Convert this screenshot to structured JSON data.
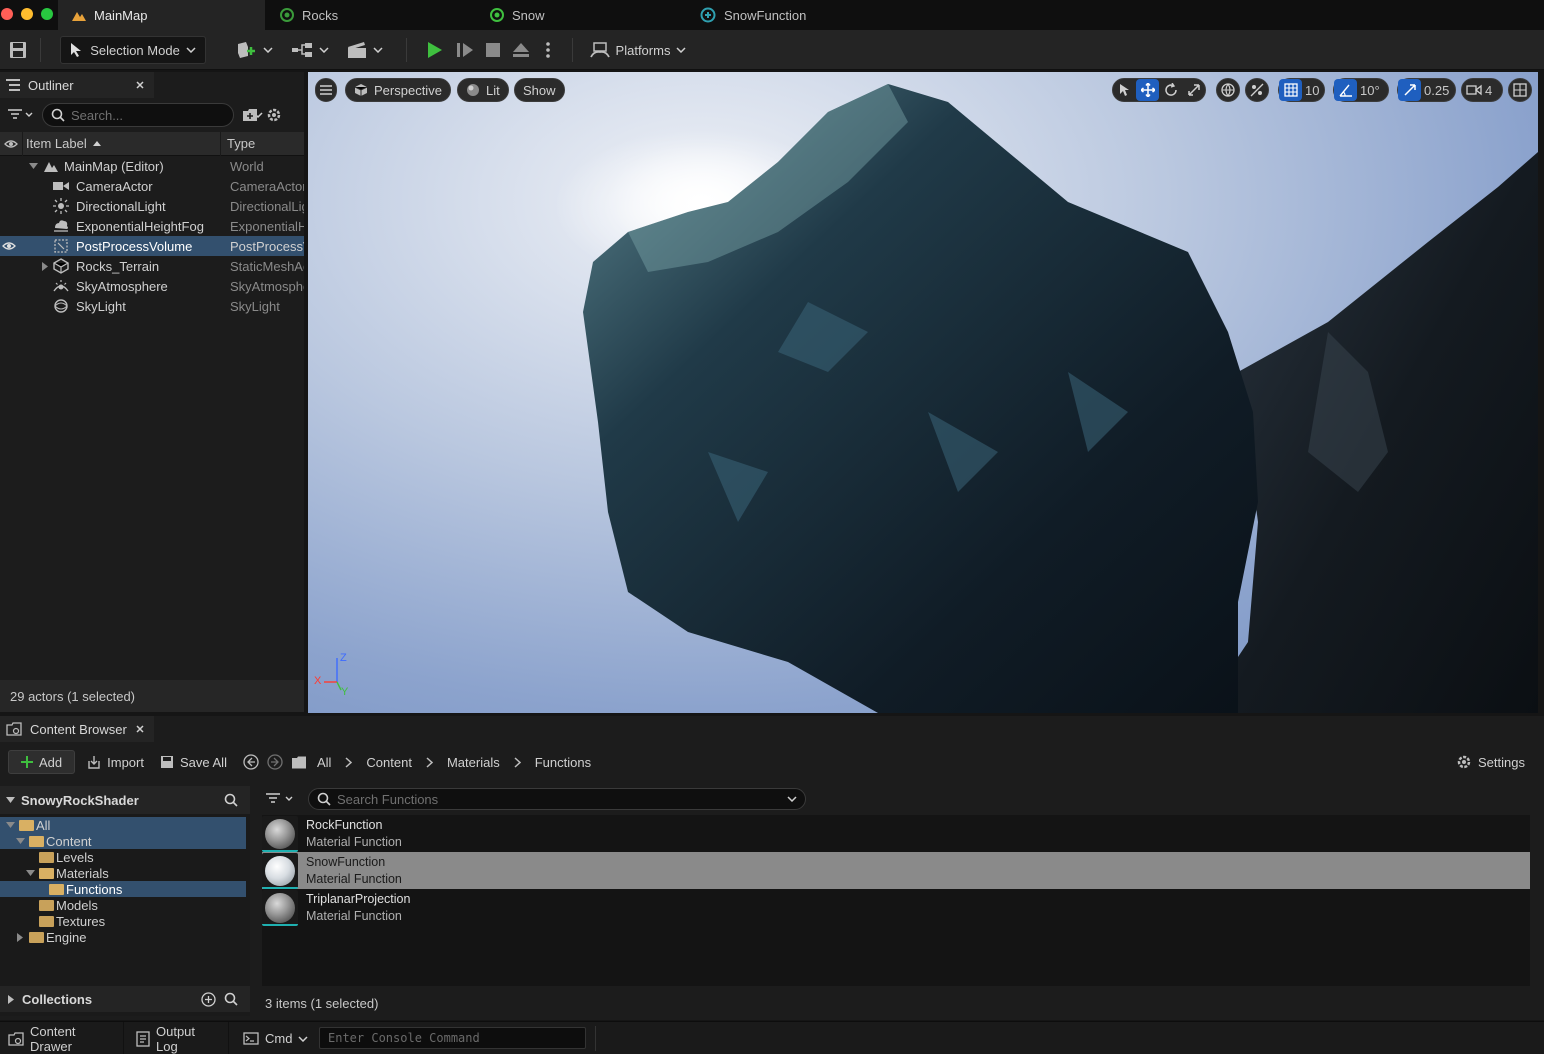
{
  "window": {
    "tabs": [
      {
        "label": "MainMap",
        "active": true
      },
      {
        "label": "Rocks",
        "active": false
      },
      {
        "label": "Snow",
        "active": false
      },
      {
        "label": "SnowFunction",
        "active": false
      }
    ]
  },
  "toolbar": {
    "selection_mode": "Selection Mode",
    "platforms": "Platforms"
  },
  "outliner": {
    "tab_label": "Outliner",
    "search_placeholder": "Search...",
    "col_label": "Item Label",
    "col_type": "Type",
    "rows": [
      {
        "label": "MainMap (Editor)",
        "type": "World"
      },
      {
        "label": "CameraActor",
        "type": "CameraActor"
      },
      {
        "label": "DirectionalLight",
        "type": "DirectionalLight"
      },
      {
        "label": "ExponentialHeightFog",
        "type": "ExponentialHeightFog"
      },
      {
        "label": "PostProcessVolume",
        "type": "PostProcessVolume",
        "selected": true
      },
      {
        "label": "Rocks_Terrain",
        "type": "StaticMeshActor"
      },
      {
        "label": "SkyAtmosphere",
        "type": "SkyAtmosphere"
      },
      {
        "label": "SkyLight",
        "type": "SkyLight"
      }
    ],
    "status": "29 actors (1 selected)"
  },
  "viewport": {
    "perspective": "Perspective",
    "lit": "Lit",
    "show": "Show",
    "grid_snap": "10",
    "rot_snap": "10°",
    "scale_snap": "0.25",
    "camera_speed": "4",
    "axis": {
      "x": "X",
      "y": "Y",
      "z": "Z"
    }
  },
  "content_browser": {
    "tab_label": "Content Browser",
    "add": "Add",
    "import": "Import",
    "save_all": "Save All",
    "breadcrumbs": [
      "All",
      "Content",
      "Materials",
      "Functions"
    ],
    "settings": "Settings",
    "project": "SnowyRockShader",
    "tree": [
      {
        "label": "All"
      },
      {
        "label": "Content"
      },
      {
        "label": "Levels"
      },
      {
        "label": "Materials"
      },
      {
        "label": "Functions"
      },
      {
        "label": "Models"
      },
      {
        "label": "Textures"
      },
      {
        "label": "Engine"
      }
    ],
    "collections": "Collections",
    "search_placeholder": "Search Functions",
    "assets": [
      {
        "name": "RockFunction",
        "type": "Material Function"
      },
      {
        "name": "SnowFunction",
        "type": "Material Function",
        "selected": true
      },
      {
        "name": "TriplanarProjection",
        "type": "Material Function"
      }
    ],
    "status": "3 items (1 selected)"
  },
  "statusbar": {
    "content_drawer": "Content Drawer",
    "output_log": "Output Log",
    "cmd": "Cmd",
    "console_placeholder": "Enter Console Command"
  },
  "colors": {
    "selection_blue": "#33506e",
    "accent_blue": "#1f5fbf",
    "play_green": "#3fbf3f",
    "folder": "#c8a15a"
  }
}
